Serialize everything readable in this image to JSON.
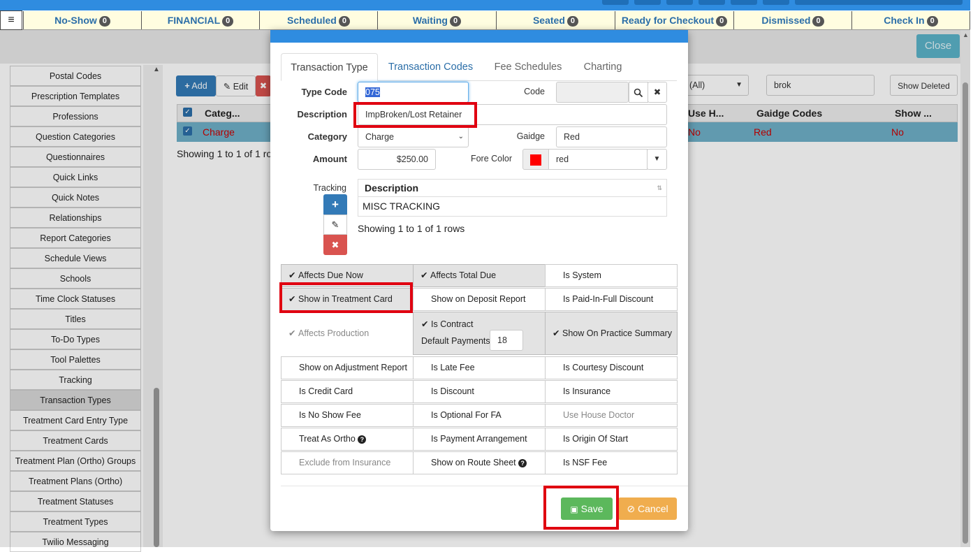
{
  "status_tabs": [
    {
      "label": "No-Show",
      "count": "0"
    },
    {
      "label": "FINANCIAL",
      "count": "0"
    },
    {
      "label": "Scheduled",
      "count": "0"
    },
    {
      "label": "Waiting",
      "count": "0"
    },
    {
      "label": "Seated",
      "count": "0"
    },
    {
      "label": "Ready for Checkout",
      "count": "0"
    },
    {
      "label": "Dismissed",
      "count": "0"
    },
    {
      "label": "Check In",
      "count": "0"
    }
  ],
  "header": {
    "close_label": "Close"
  },
  "sidebar": {
    "items": [
      "Postal Codes",
      "Prescription Templates",
      "Professions",
      "Question Categories",
      "Questionnaires",
      "Quick Links",
      "Quick Notes",
      "Relationships",
      "Report Categories",
      "Schedule Views",
      "Schools",
      "Time Clock Statuses",
      "Titles",
      "To-Do Types",
      "Tool Palettes",
      "Tracking",
      "Transaction Types",
      "Treatment Card Entry Type",
      "Treatment Cards",
      "Treatment Plan (Ortho) Groups",
      "Treatment Plans (Ortho)",
      "Treatment Statuses",
      "Treatment Types",
      "Twilio Messaging"
    ],
    "active_index": 16
  },
  "toolbar": {
    "add_label": "Add",
    "edit_label": "Edit",
    "filter_value": "(All)",
    "search_value": "brok",
    "show_deleted_label": "Show Deleted"
  },
  "grid": {
    "headers": {
      "category": "Categ...",
      "use_h": "Use H...",
      "gaidge": "Gaidge Codes",
      "show": "Show ..."
    },
    "row": {
      "category": "Charge",
      "use_h": "No",
      "gaidge": "Red",
      "show": "No"
    },
    "footer": "Showing 1 to 1 of 1 ro"
  },
  "modal": {
    "tabs": [
      "Transaction Type",
      "Transaction Codes",
      "Fee Schedules",
      "Charting"
    ],
    "active_tab": 0,
    "labels": {
      "type_code": "Type Code",
      "code": "Code",
      "description": "Description",
      "category": "Category",
      "gaidge": "Gaidge",
      "amount": "Amount",
      "fore_color": "Fore Color",
      "tracking": "Tracking"
    },
    "values": {
      "type_code": "075",
      "code": "",
      "description": "ImpBroken/Lost Retainer",
      "category": "Charge",
      "gaidge": "Red",
      "amount": "$250.00",
      "fore_color": "red",
      "fore_color_hex": "#ff0000"
    },
    "tracking_table": {
      "header": "Description",
      "rows": [
        "MISC TRACKING"
      ],
      "footer": "Showing 1 to 1 of 1 rows"
    },
    "checks": {
      "affects_due_now": "Affects Due Now",
      "affects_total_due": "Affects Total Due",
      "is_system": "Is System",
      "show_in_treatment_card": "Show in Treatment Card",
      "show_on_deposit_report": "Show on Deposit Report",
      "is_paid_in_full_discount": "Is Paid-In-Full Discount",
      "affects_production": "Affects Production",
      "is_contract": "Is Contract",
      "default_payments_label": "Default Payments",
      "default_payments_value": "18",
      "show_on_practice_summary": "Show On Practice Summary",
      "show_on_adjustment_report": "Show on Adjustment Report",
      "is_late_fee": "Is Late Fee",
      "is_courtesy_discount": "Is Courtesy Discount",
      "is_credit_card": "Is Credit Card",
      "is_discount": "Is Discount",
      "is_insurance": "Is Insurance",
      "is_no_show_fee": "Is No Show Fee",
      "is_optional_for_fa": "Is Optional For FA",
      "use_house_doctor": "Use House Doctor",
      "treat_as_ortho": "Treat As Ortho",
      "is_payment_arrangement": "Is Payment Arrangement",
      "is_origin_of_start": "Is Origin Of Start",
      "exclude_from_insurance": "Exclude from Insurance",
      "show_on_route_sheet": "Show on Route Sheet",
      "is_nsf_fee": "Is NSF Fee"
    },
    "buttons": {
      "save": "Save",
      "cancel": "Cancel"
    }
  },
  "colors": {
    "accent": "#2f8ce0",
    "save": "#5cb85c",
    "cancel": "#f0ad4e",
    "delete": "#d9534f",
    "highlight": "#e00010"
  }
}
